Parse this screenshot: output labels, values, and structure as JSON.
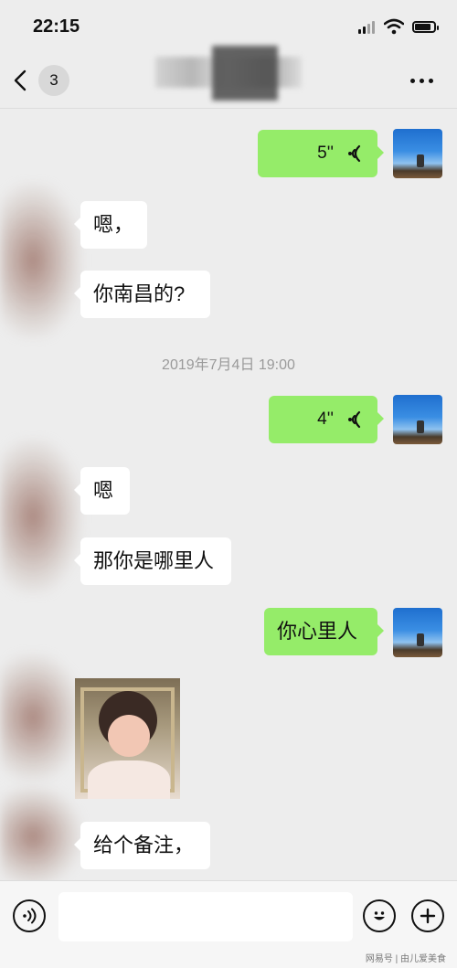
{
  "status_bar": {
    "time": "22:15"
  },
  "nav": {
    "unread_count": "3"
  },
  "messages": [
    {
      "side": "out",
      "type": "voice",
      "duration": "5''"
    },
    {
      "side": "in",
      "type": "text",
      "text": "嗯，"
    },
    {
      "side": "in",
      "type": "text",
      "text": "你南昌的?"
    },
    {
      "side": "system",
      "type": "time",
      "text": "2019年7月4日 19:00"
    },
    {
      "side": "out",
      "type": "voice",
      "duration": "4''"
    },
    {
      "side": "in",
      "type": "text",
      "text": "嗯"
    },
    {
      "side": "in",
      "type": "text",
      "text": "那你是哪里人"
    },
    {
      "side": "out",
      "type": "text",
      "text": "你心里人"
    },
    {
      "side": "in",
      "type": "sticker",
      "description_icon": "girl-covering-face-sticker"
    },
    {
      "side": "in",
      "type": "text",
      "text": "给个备注，"
    }
  ],
  "input_bar": {
    "voice_icon": "voice-mode-icon",
    "emoji_icon": "emoji-icon",
    "add_icon": "plus-icon"
  },
  "watermark": "网易号 | 由儿爱美食",
  "colors": {
    "background": "#ededed",
    "outgoing_bubble": "#95ec69",
    "incoming_bubble": "#ffffff",
    "timestamp": "#9a9a9a"
  }
}
